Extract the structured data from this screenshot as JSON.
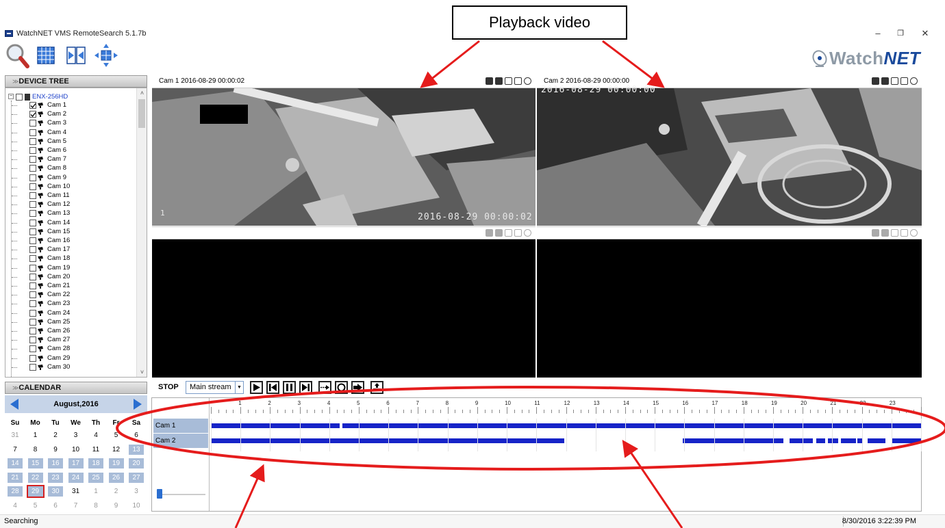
{
  "annotation": {
    "callout_label": "Playback video"
  },
  "window": {
    "title": "WatchNET VMS RemoteSearch 5.1.7b",
    "minimize": "–",
    "maximize": "❐",
    "close": "✕"
  },
  "logo": {
    "part1": "Watch",
    "part2": "NET"
  },
  "toolbar": {
    "buttons": [
      {
        "name": "search-mode-button",
        "icon": "magnifier-icon"
      },
      {
        "name": "grid-layout-button",
        "icon": "grid-icon"
      },
      {
        "name": "split-view-button",
        "icon": "split-icon"
      },
      {
        "name": "ptz-button",
        "icon": "ptz-arrows-icon"
      }
    ]
  },
  "device_tree": {
    "header": "DEVICE TREE",
    "device": "ENX-256HD",
    "cameras": [
      {
        "label": "Cam 1",
        "checked": true
      },
      {
        "label": "Cam 2",
        "checked": true
      },
      {
        "label": "Cam 3",
        "checked": false
      },
      {
        "label": "Cam 4",
        "checked": false
      },
      {
        "label": "Cam 5",
        "checked": false
      },
      {
        "label": "Cam 6",
        "checked": false
      },
      {
        "label": "Cam 7",
        "checked": false
      },
      {
        "label": "Cam 8",
        "checked": false
      },
      {
        "label": "Cam 9",
        "checked": false
      },
      {
        "label": "Cam 10",
        "checked": false
      },
      {
        "label": "Cam 11",
        "checked": false
      },
      {
        "label": "Cam 12",
        "checked": false
      },
      {
        "label": "Cam 13",
        "checked": false
      },
      {
        "label": "Cam 14",
        "checked": false
      },
      {
        "label": "Cam 15",
        "checked": false
      },
      {
        "label": "Cam 16",
        "checked": false
      },
      {
        "label": "Cam 17",
        "checked": false
      },
      {
        "label": "Cam 18",
        "checked": false
      },
      {
        "label": "Cam 19",
        "checked": false
      },
      {
        "label": "Cam 20",
        "checked": false
      },
      {
        "label": "Cam 21",
        "checked": false
      },
      {
        "label": "Cam 22",
        "checked": false
      },
      {
        "label": "Cam 23",
        "checked": false
      },
      {
        "label": "Cam 24",
        "checked": false
      },
      {
        "label": "Cam 25",
        "checked": false
      },
      {
        "label": "Cam 26",
        "checked": false
      },
      {
        "label": "Cam 27",
        "checked": false
      },
      {
        "label": "Cam 28",
        "checked": false
      },
      {
        "label": "Cam 29",
        "checked": false
      },
      {
        "label": "Cam 30",
        "checked": false
      }
    ]
  },
  "calendar": {
    "header": "CALENDAR",
    "month_label": "August,2016",
    "weekdays": [
      "Su",
      "Mo",
      "Tu",
      "We",
      "Th",
      "Fr",
      "Sa"
    ],
    "weeks": [
      [
        {
          "d": "31",
          "t": "other"
        },
        {
          "d": "1",
          "t": "normal"
        },
        {
          "d": "2",
          "t": "normal"
        },
        {
          "d": "3",
          "t": "normal"
        },
        {
          "d": "4",
          "t": "normal"
        },
        {
          "d": "5",
          "t": "normal"
        },
        {
          "d": "6",
          "t": "normal"
        }
      ],
      [
        {
          "d": "7",
          "t": "normal"
        },
        {
          "d": "8",
          "t": "normal"
        },
        {
          "d": "9",
          "t": "normal"
        },
        {
          "d": "10",
          "t": "normal"
        },
        {
          "d": "11",
          "t": "normal"
        },
        {
          "d": "12",
          "t": "normal"
        },
        {
          "d": "13",
          "t": "rec"
        }
      ],
      [
        {
          "d": "14",
          "t": "rec"
        },
        {
          "d": "15",
          "t": "rec"
        },
        {
          "d": "16",
          "t": "rec"
        },
        {
          "d": "17",
          "t": "rec"
        },
        {
          "d": "18",
          "t": "rec"
        },
        {
          "d": "19",
          "t": "rec"
        },
        {
          "d": "20",
          "t": "rec"
        }
      ],
      [
        {
          "d": "21",
          "t": "rec"
        },
        {
          "d": "22",
          "t": "rec"
        },
        {
          "d": "23",
          "t": "rec"
        },
        {
          "d": "24",
          "t": "rec"
        },
        {
          "d": "25",
          "t": "rec"
        },
        {
          "d": "26",
          "t": "rec"
        },
        {
          "d": "27",
          "t": "rec"
        }
      ],
      [
        {
          "d": "28",
          "t": "rec"
        },
        {
          "d": "29",
          "t": "sel"
        },
        {
          "d": "30",
          "t": "rec"
        },
        {
          "d": "31",
          "t": "normal"
        },
        {
          "d": "1",
          "t": "other"
        },
        {
          "d": "2",
          "t": "other"
        },
        {
          "d": "3",
          "t": "other"
        }
      ],
      [
        {
          "d": "4",
          "t": "other"
        },
        {
          "d": "5",
          "t": "other"
        },
        {
          "d": "6",
          "t": "other"
        },
        {
          "d": "7",
          "t": "other"
        },
        {
          "d": "8",
          "t": "other"
        },
        {
          "d": "9",
          "t": "other"
        },
        {
          "d": "10",
          "t": "other"
        }
      ]
    ]
  },
  "video": {
    "cells": [
      {
        "label": "Cam 1  2016-08-29 00:00:02",
        "osd_time": "2016-08-29 00:00:02",
        "osd_channel": "1",
        "active": true
      },
      {
        "label": "Cam 2  2016-08-29 00:00:00",
        "osd_time": "2016-08-29 00:00:00",
        "active": true
      },
      {
        "label": "",
        "active": false
      },
      {
        "label": "",
        "active": false
      }
    ]
  },
  "playback": {
    "state": "STOP",
    "stream": "Main stream",
    "buttons": [
      "play",
      "step-back",
      "pause",
      "step-forward",
      "goto-time",
      "record",
      "export",
      "backup"
    ]
  },
  "timeline": {
    "hours": [
      "1",
      "2",
      "3",
      "4",
      "5",
      "6",
      "7",
      "8",
      "9",
      "10",
      "11",
      "12",
      "13",
      "14",
      "15",
      "16",
      "17",
      "18",
      "19",
      "20",
      "21",
      "22",
      "23"
    ],
    "rows": [
      {
        "label": "Cam 1",
        "segments": [
          [
            0,
            4.35
          ],
          [
            4.45,
            24
          ]
        ]
      },
      {
        "label": "Cam 2",
        "segments": [
          [
            0,
            11.95
          ],
          [
            15.95,
            19.35
          ],
          [
            19.55,
            20.35
          ],
          [
            20.45,
            20.75
          ],
          [
            20.85,
            21.2
          ],
          [
            21.3,
            21.8
          ],
          [
            21.85,
            22.0
          ],
          [
            22.2,
            22.8
          ],
          [
            23.0,
            24
          ]
        ]
      }
    ]
  },
  "status": {
    "left": "Searching",
    "right": "8/30/2016 3:22:39 PM"
  },
  "colors": {
    "recording_bar": "#1624c8",
    "annotation_red": "#e51c1c",
    "calendar_record": "#a8bcd8"
  }
}
